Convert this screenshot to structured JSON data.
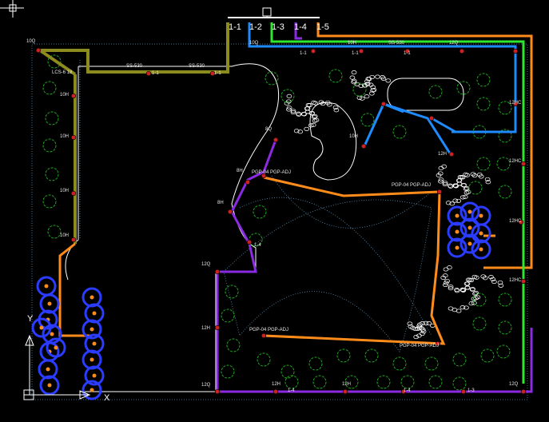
{
  "app": {
    "window": "AutoCAD drawing - irrigation layout"
  },
  "valve_header": {
    "labels": [
      "1-1",
      "1-2",
      "1-3",
      "1-4",
      "1-5"
    ]
  },
  "zone_labels": {
    "z1a": "1-1",
    "z1b": "1-1",
    "z1c": "1-4",
    "z1d": "1-4",
    "z1e": "1-4",
    "z1f": "1-3",
    "z1g": "1-1",
    "z1h": "1-1",
    "z1i": "1-1"
  },
  "head_labels": {
    "h10q_top": "10Q",
    "h10q_a": "10Q",
    "h10h_a": "10H",
    "h10h_b": "10H",
    "h10h_c": "10H",
    "h10h_d": "10H",
    "h10h_e": "10H",
    "h12q_a": "12Q",
    "h12q_b": "12Q",
    "h12h_a": "12H",
    "h12h_b": "12H",
    "h12h_c": "12H",
    "h12hc_a": "12HC",
    "h12hc_b": "12HC",
    "h12hc_c": "12HC",
    "h12hc_d": "12HC",
    "h8q": "8Q",
    "h8h_a": "8H",
    "h8h_b": "8H",
    "h10h_f": "10H",
    "h12q_c": "12Q",
    "h12h_d": "12H",
    "h12q_d": "12Q"
  },
  "pipe_labels": {
    "lcs": "LCS-6 18",
    "ss1": "SS-530",
    "ss2": "SS-530",
    "ss3": "SS-530",
    "pgp1": "PGP-04 PGP-ADJ",
    "pgp2": "PGP-04 PGP-ADJ",
    "pgp3": "PGP-04 PGP-ADJ",
    "pgp4": "PGP-04 PGP-ADJ"
  },
  "ucs_icon": {
    "x_label": "X",
    "y_label": "Y"
  },
  "colors": {
    "background": "#000000",
    "olive_pipe": "#8b8b1e",
    "blue_pipe": "#1e8cff",
    "orange_pipe": "#ff8c1a",
    "purple_pipe": "#8a2be2",
    "green_pipe": "#2ee82e",
    "shrub": "#1fa81f",
    "rock": "#ffffff",
    "head": "#cc2222",
    "bubbler": "#2a3cff"
  }
}
